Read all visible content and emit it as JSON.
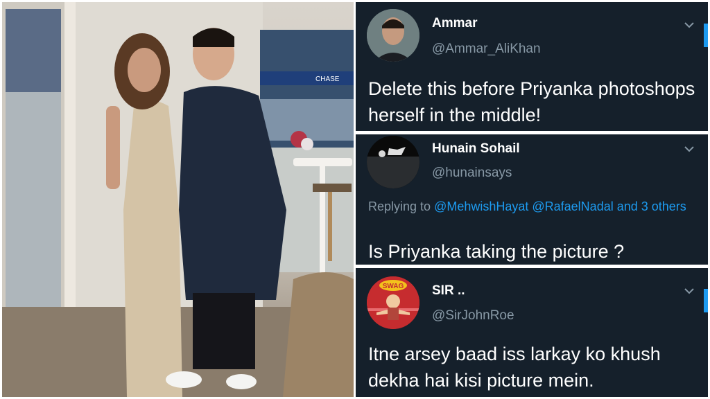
{
  "tweets": [
    {
      "name": "Ammar",
      "handle": "@Ammar_AliKhan",
      "text": "Delete this before Priyanka photoshops herself in the middle!"
    },
    {
      "name": "Hunain Sohail",
      "handle": "@hunainsays",
      "replying_prefix": "Replying to ",
      "replying_mentions": "@MehwishHayat @RafaelNadal and 3 others",
      "text": "Is Priyanka taking the picture ?"
    },
    {
      "name": "SIR ..",
      "handle": "@SirJohnRoe",
      "avatar_badge": "SWAG",
      "text": "Itne arsey baad iss larkay ko khush dekha hai kisi picture mein."
    }
  ],
  "photo": {
    "stadium_sign": "CHASE"
  },
  "colors": {
    "tweet_bg": "#15202b",
    "name_text": "#ffffff",
    "handle_text": "#8899a6",
    "mention": "#1d9bf0"
  },
  "icons": [
    "chevron-down-icon",
    "avatar"
  ]
}
